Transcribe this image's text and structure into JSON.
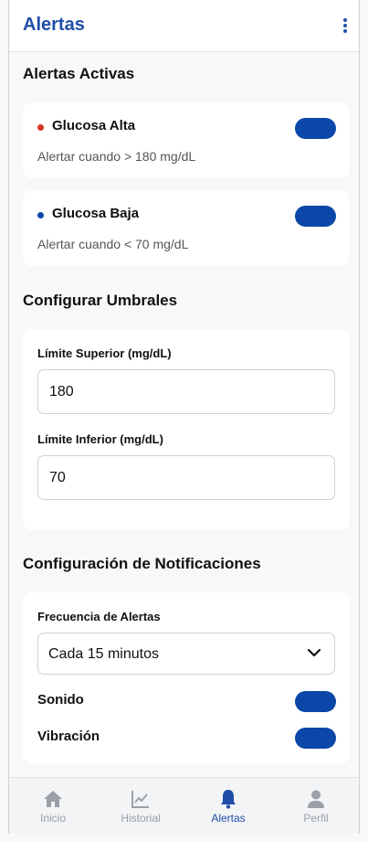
{
  "appbar": {
    "title": "Alertas",
    "menu_icon": "kebab-menu-icon"
  },
  "active_alerts": {
    "title": "Alertas Activas",
    "items": [
      {
        "name": "Glucosa Alta",
        "description": "Alertar cuando > 180 mg/dL",
        "dot_color": "#d93025",
        "enabled": true
      },
      {
        "name": "Glucosa Baja",
        "description": "Alertar cuando < 70 mg/dL",
        "dot_color": "#0a47a8",
        "enabled": true
      }
    ]
  },
  "thresholds": {
    "title": "Configurar Umbrales",
    "upper_label": "Límite Superior (mg/dL)",
    "upper_value": "180",
    "lower_label": "Límite Inferior (mg/dL)",
    "lower_value": "70"
  },
  "notifications": {
    "title": "Configuración de Notificaciones",
    "frequency_label": "Frecuencia de Alertas",
    "frequency_value": "Cada 15 minutos",
    "sound_label": "Sonido",
    "sound_enabled": true,
    "vibration_label": "Vibración",
    "vibration_enabled": true
  },
  "bottom_nav": {
    "items": [
      {
        "label": "Inicio",
        "icon": "home-icon",
        "active": false
      },
      {
        "label": "Historial",
        "icon": "chart-line-icon",
        "active": false
      },
      {
        "label": "Alertas",
        "icon": "bell-icon",
        "active": true
      },
      {
        "label": "Perfil",
        "icon": "user-icon",
        "active": false
      }
    ]
  },
  "colors": {
    "accent": "#1f4ea8",
    "toggle_on": "#0a47a8",
    "inactive_nav": "#9aa0a8"
  }
}
